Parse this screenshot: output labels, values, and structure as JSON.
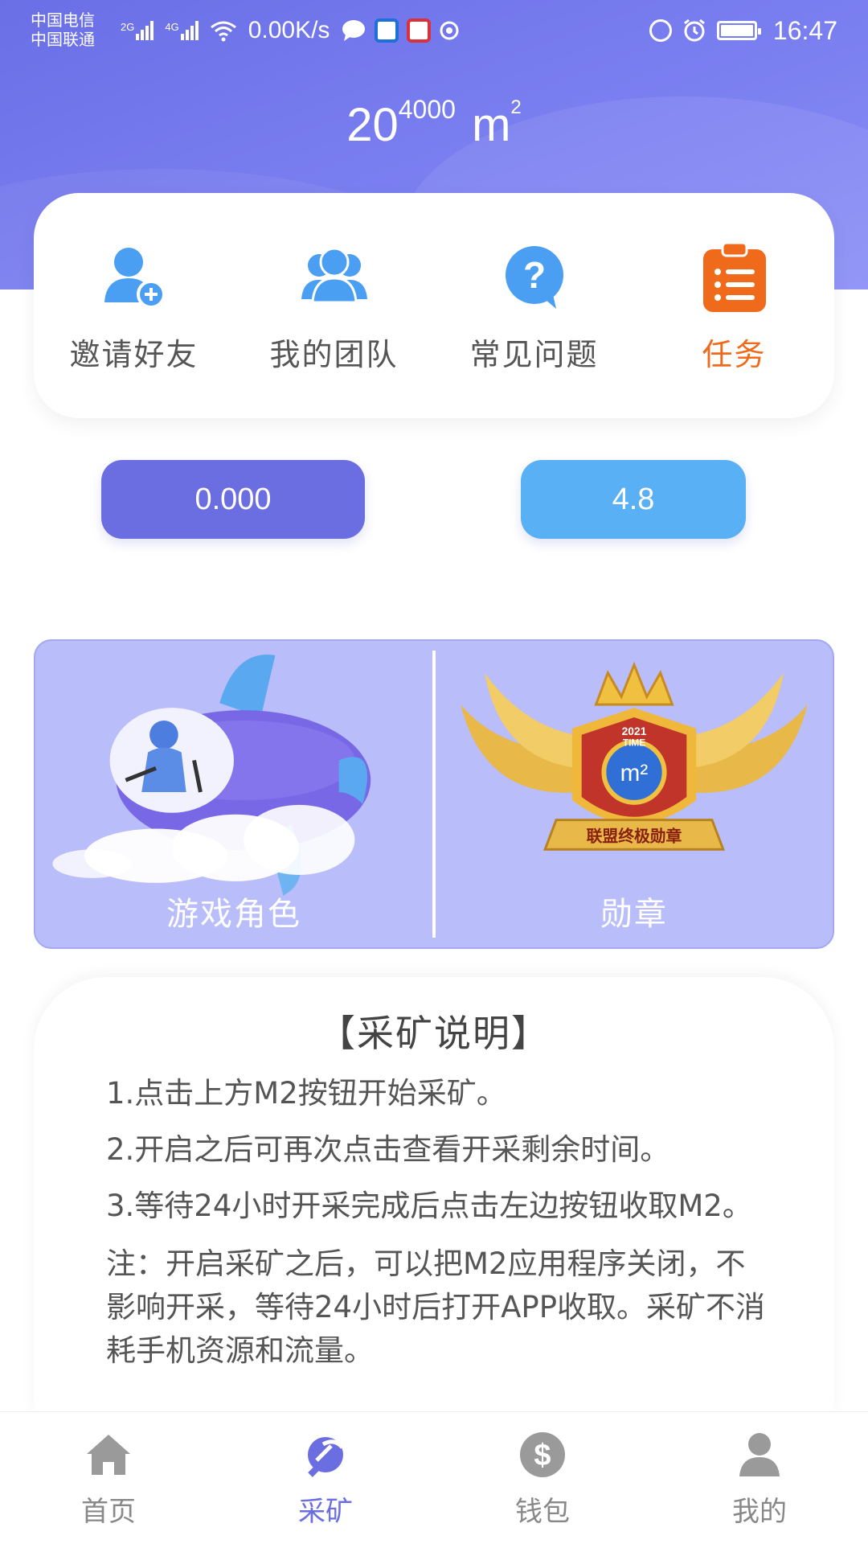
{
  "status_bar": {
    "carrier_1": "中国电信",
    "carrier_2": "中国联通",
    "signal_1_tag": "2G",
    "signal_2_tag": "4G",
    "net_speed": "0.00K/s",
    "time": "16:47"
  },
  "header": {
    "base": "20",
    "exponent": "4000",
    "unit": "m",
    "unit_exponent": "2"
  },
  "quick_actions": [
    {
      "label": "邀请好友",
      "icon": "invite-friend-icon"
    },
    {
      "label": "我的团队",
      "icon": "team-icon"
    },
    {
      "label": "常见问题",
      "icon": "faq-icon"
    },
    {
      "label": "任务",
      "icon": "task-clipboard-icon"
    }
  ],
  "values": {
    "left": "0.000",
    "right": "4.8"
  },
  "features": {
    "game_role": {
      "label": "游戏角色"
    },
    "medal": {
      "label": "勋章",
      "badge_year": "2021",
      "badge_word": "TIME",
      "badge_center": "m²",
      "badge_ribbon": "联盟终极勋章"
    }
  },
  "mining": {
    "title": "【采矿说明】",
    "steps": [
      "1.点击上方M2按钮开始采矿。",
      "2.开启之后可再次点击查看开采剩余时间。",
      "3.等待24小时开采完成后点击左边按钮收取M2。"
    ],
    "note": "注：开启采矿之后，可以把M2应用程序关闭，不影响开采，等待24小时后打开APP收取。采矿不消耗手机资源和流量。"
  },
  "nav": [
    {
      "label": "首页",
      "icon": "home-icon"
    },
    {
      "label": "采矿",
      "icon": "pickaxe-icon"
    },
    {
      "label": "钱包",
      "icon": "wallet-dollar-icon"
    },
    {
      "label": "我的",
      "icon": "profile-icon"
    }
  ],
  "colors": {
    "primary": "#6b6ee0",
    "secondary": "#5ab0f5",
    "task_accent": "#f06a1c",
    "panel": "#b9bdfa"
  }
}
